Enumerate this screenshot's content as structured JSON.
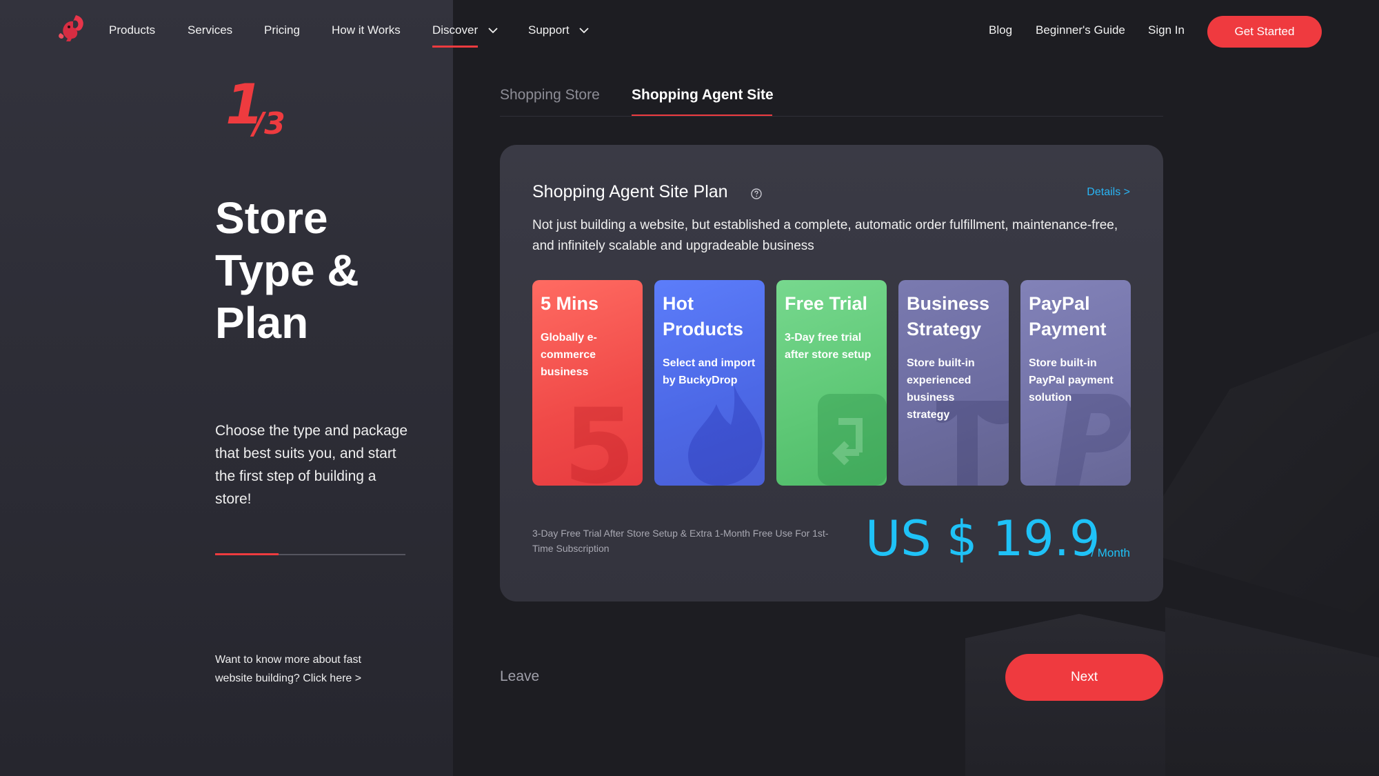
{
  "nav": {
    "items": [
      {
        "label": "Products"
      },
      {
        "label": "Services"
      },
      {
        "label": "Pricing"
      },
      {
        "label": "How it Works"
      },
      {
        "label": "Discover",
        "active": true
      },
      {
        "label": "Support"
      }
    ],
    "right": [
      {
        "label": "Blog"
      },
      {
        "label": "Beginner's Guide"
      },
      {
        "label": "Sign In"
      }
    ],
    "cta_label": "Get Started"
  },
  "step": {
    "current": "1",
    "total": "/3"
  },
  "hero": {
    "title": "Store Type & Plan",
    "description": "Choose the type and package that best suits you, and start the first step of building a store!",
    "progress": 0.333,
    "more_link": "Want to know more about fast website building? Click here >"
  },
  "tabs": [
    {
      "label": "Shopping Store",
      "active": false
    },
    {
      "label": "Shopping Agent Site",
      "active": true
    }
  ],
  "plan": {
    "title": "Shopping Agent Site Plan",
    "details_label": "Details >",
    "description": "Not just building a website, but established a complete, automatic order fulfillment, maintenance-free, and infinitely scalable and upgradeable business",
    "features": [
      {
        "title": "5 Mins",
        "desc": "Globally e-commerce business",
        "icon": "five-watermark-icon"
      },
      {
        "title": "Hot Products",
        "desc": "Select and import by BuckyDrop",
        "icon": "flame-watermark-icon"
      },
      {
        "title": "Free Trial",
        "desc": "3-Day free trial after store setup",
        "icon": "gift-watermark-icon"
      },
      {
        "title": "Business Strategy",
        "desc": "Store built-in experienced business strategy",
        "icon": "strategy-watermark-icon"
      },
      {
        "title": "PayPal Payment",
        "desc": "Store built-in PayPal payment solution",
        "icon": "paypal-watermark-icon"
      }
    ],
    "trial_note": "3-Day Free Trial After Store Setup & Extra 1-Month Free Use For 1st-Time Subscription",
    "price": "US $ 19.9",
    "price_unit": "/ Month"
  },
  "footer": {
    "leave_label": "Leave",
    "next_label": "Next"
  },
  "colors": {
    "accent": "#ef3a3f",
    "price": "#1fc2f7",
    "link": "#29b6f6"
  }
}
